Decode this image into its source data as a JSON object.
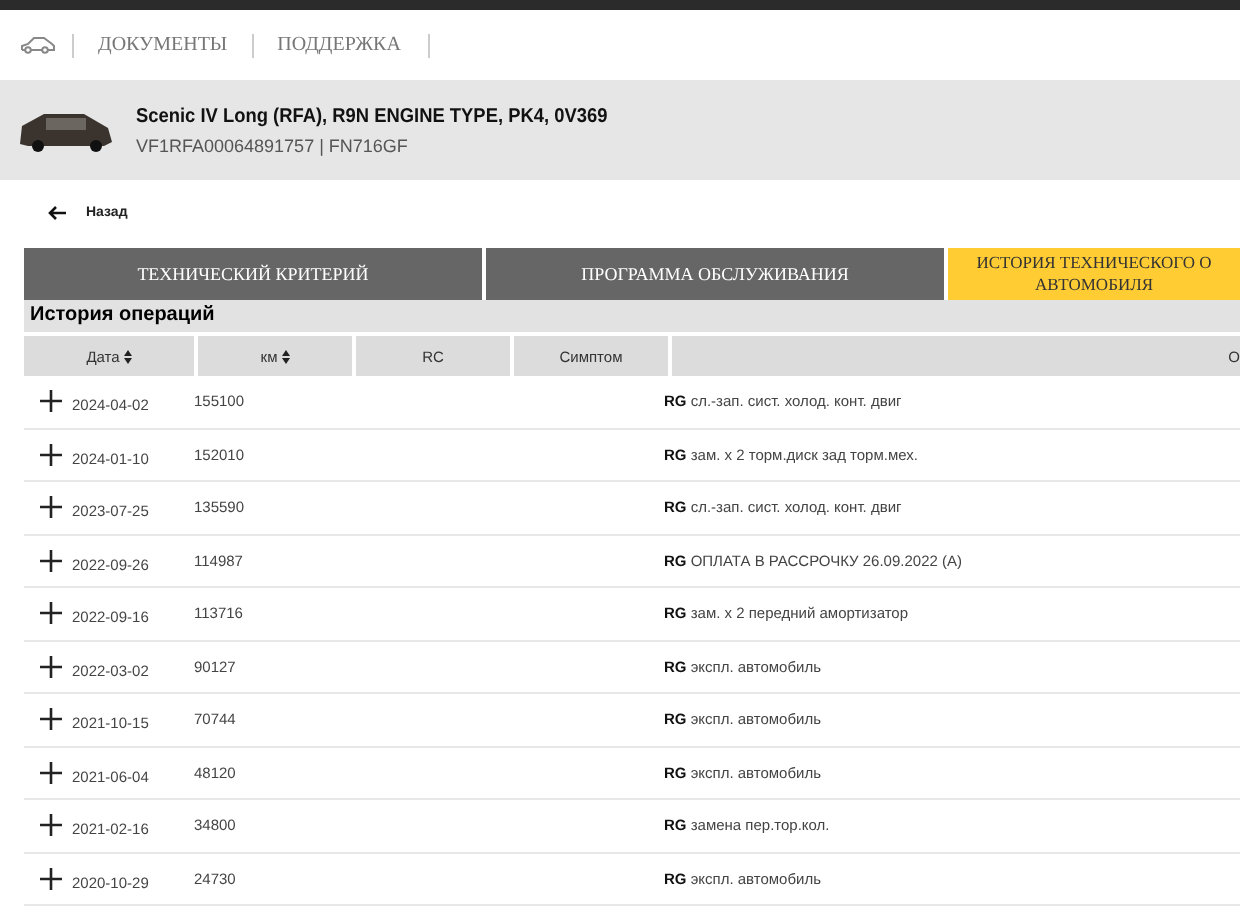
{
  "nav": {
    "items": [
      "ДОКУМЕНТЫ",
      "ПОДДЕРЖКА"
    ]
  },
  "vehicle": {
    "title": "Scenic IV Long (RFA), R9N ENGINE TYPE, PK4, 0V369",
    "subtitle": "VF1RFA00064891757 | FN716GF"
  },
  "back": "Назад",
  "tabs": [
    {
      "lines": [
        "ТЕХНИЧЕСКИЙ КРИТЕРИЙ"
      ],
      "selected": false
    },
    {
      "lines": [
        "ПРОГРАММА ОБСЛУЖИВАНИЯ"
      ],
      "selected": false
    },
    {
      "lines": [
        "ИСТОРИЯ ТЕХНИЧЕСКОГО О",
        "АВТОМОБИЛЯ"
      ],
      "selected": true
    }
  ],
  "section_title": "История операций",
  "table": {
    "columns": [
      {
        "label": "Дата",
        "sortable": true
      },
      {
        "label": "км",
        "sortable": true
      },
      {
        "label": "RC",
        "sortable": false
      },
      {
        "label": "Симптом",
        "sortable": false
      },
      {
        "label": "О",
        "sortable": false
      }
    ],
    "rows": [
      {
        "date": "2024-04-02",
        "km": "155100",
        "operation": "**RG** сл.-зап. сист. холод. конт. двиг"
      },
      {
        "date": "2024-01-10",
        "km": "152010",
        "operation": "**RG** зам. x 2 торм.диск зад торм.мех."
      },
      {
        "date": "2023-07-25",
        "km": "135590",
        "operation": "**RG** сл.-зап. сист. холод. конт. двиг"
      },
      {
        "date": "2022-09-26",
        "km": "114987",
        "operation": "**RG** ОПЛАТА В РАССРОЧКУ 26.09.2022 (A)"
      },
      {
        "date": "2022-09-16",
        "km": "113716",
        "operation": "**RG** зам. x 2 передний амортизатор"
      },
      {
        "date": "2022-03-02",
        "km": "90127",
        "operation": "**RG** экспл. автомобиль"
      },
      {
        "date": "2021-10-15",
        "km": "70744",
        "operation": "**RG** экспл. автомобиль"
      },
      {
        "date": "2021-06-04",
        "km": "48120",
        "operation": "**RG** экспл. автомобиль"
      },
      {
        "date": "2021-02-16",
        "km": "34800",
        "operation": "**RG** замена пер.тор.кол."
      },
      {
        "date": "2020-10-29",
        "km": "24730",
        "operation": "**RG** экспл. автомобиль"
      }
    ]
  }
}
